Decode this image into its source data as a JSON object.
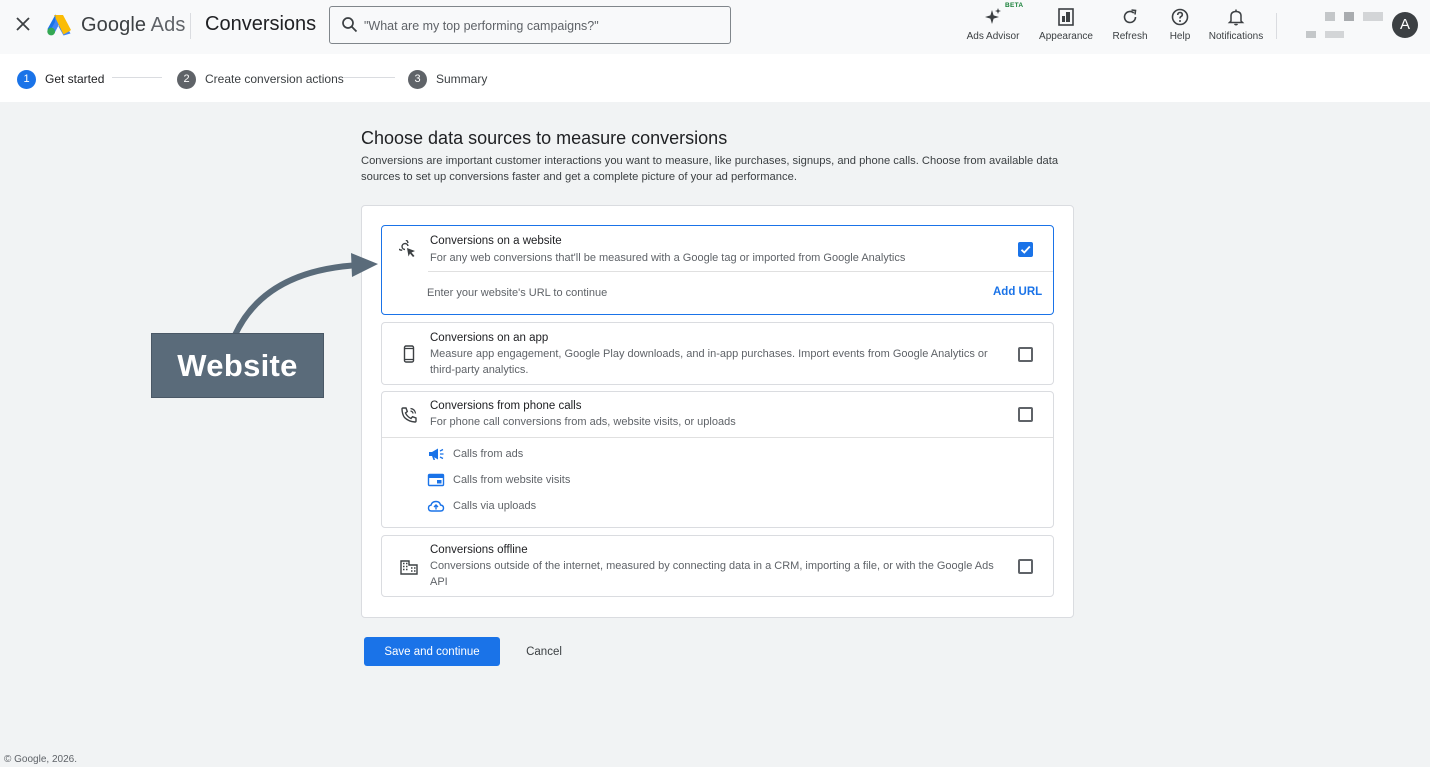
{
  "header": {
    "brand_google": "Google",
    "brand_ads": "Ads",
    "page_title": "Conversions",
    "search_placeholder": "\"What are my top performing campaigns?\"",
    "tools": {
      "ads_advisor": "Ads Advisor",
      "beta_badge": "BETA",
      "appearance": "Appearance",
      "refresh": "Refresh",
      "help": "Help",
      "notifications": "Notifications"
    },
    "avatar_initial": "A"
  },
  "stepper": {
    "steps": [
      {
        "num": "1",
        "label": "Get started"
      },
      {
        "num": "2",
        "label": "Create conversion actions"
      },
      {
        "num": "3",
        "label": "Summary"
      }
    ]
  },
  "main": {
    "title": "Choose data sources to measure conversions",
    "description": "Conversions are important customer interactions you want to measure, like purchases, signups, and phone calls. Choose from available data sources to set up conversions faster and get a complete picture of your ad performance.",
    "options": {
      "website": {
        "title": "Conversions on a website",
        "subtitle": "For any web conversions that'll be measured with a Google tag or imported from Google Analytics",
        "checked": true,
        "url_hint": "Enter your website's URL to continue",
        "add_url": "Add URL"
      },
      "app": {
        "title": "Conversions on an app",
        "subtitle": "Measure app engagement, Google Play downloads, and in-app purchases. Import events from Google Analytics or third-party analytics.",
        "checked": false
      },
      "phone": {
        "title": "Conversions from phone calls",
        "subtitle": "For phone call conversions from ads, website visits, or uploads",
        "checked": false,
        "sub_items": [
          "Calls from ads",
          "Calls from website visits",
          "Calls via uploads"
        ]
      },
      "offline": {
        "title": "Conversions offline",
        "subtitle": "Conversions outside of the internet, measured by connecting data in a CRM, importing a file, or with the Google Ads API",
        "checked": false
      }
    },
    "save_button": "Save and continue",
    "cancel_button": "Cancel"
  },
  "annotation": {
    "label": "Website"
  },
  "footer": {
    "copyright": "© Google, 2026."
  },
  "colors": {
    "accent": "#1a73e8",
    "callout": "#5a6b7a"
  }
}
